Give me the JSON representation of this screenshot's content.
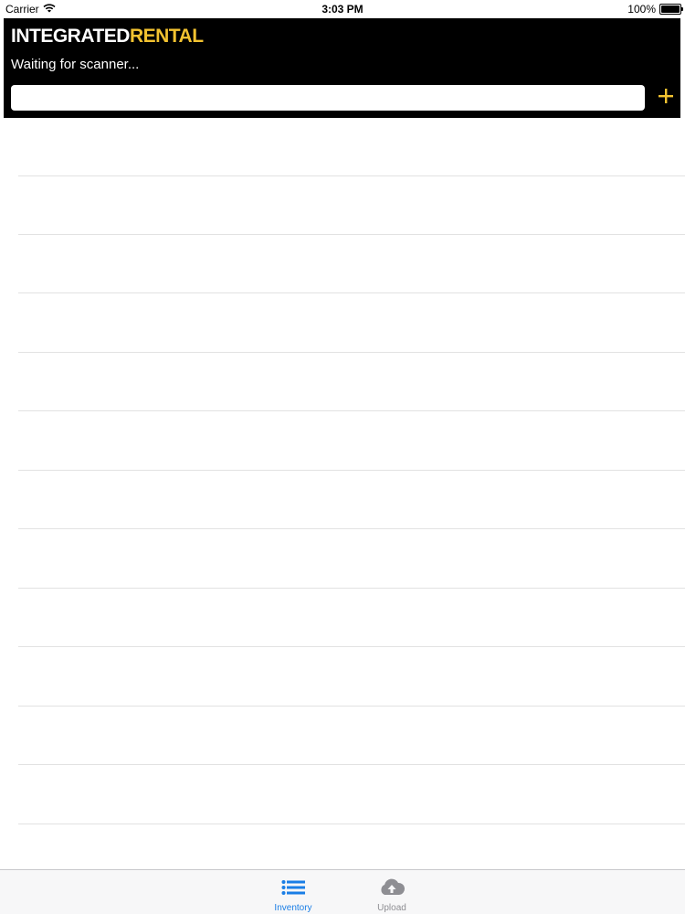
{
  "status_bar": {
    "carrier": "Carrier",
    "time": "3:03 PM",
    "battery": "100%"
  },
  "header": {
    "brand_part1": "INTEGRATED",
    "brand_part2": "RENTAL",
    "scanner_status": "Waiting for scanner...",
    "search": {
      "value": "",
      "placeholder": ""
    },
    "add_icon": "plus-icon"
  },
  "list": {
    "rows": [
      "",
      "",
      "",
      "",
      "",
      "",
      "",
      "",
      "",
      "",
      "",
      "",
      ""
    ]
  },
  "tab_bar": {
    "active_color": "#1a7ee6",
    "inactive_color": "#8e8e93",
    "tabs": [
      {
        "label": "Inventory",
        "icon": "list-icon",
        "active": true
      },
      {
        "label": "Upload",
        "icon": "cloud-upload-icon",
        "active": false
      }
    ]
  },
  "colors": {
    "header_bg": "#000000",
    "brand_accent": "#f2c230",
    "add_icon": "#f2c230"
  }
}
